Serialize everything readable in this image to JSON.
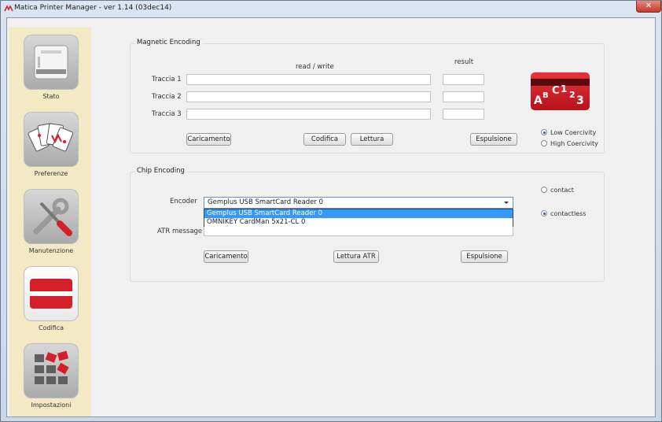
{
  "window": {
    "title": "Matica Printer Manager - ver 1.14 (03dec14)",
    "close_glyph": "✕"
  },
  "sidebar": {
    "items": [
      {
        "label": "Stato",
        "icon": "printer-icon",
        "active": false
      },
      {
        "label": "Preferenze",
        "icon": "playing-cards-icon",
        "active": false
      },
      {
        "label": "Manutenzione",
        "icon": "tools-icon",
        "active": false
      },
      {
        "label": "Codifica",
        "icon": "card-encoding-icon",
        "active": true
      },
      {
        "label": "Impostazioni",
        "icon": "settings-grid-icon",
        "active": false
      }
    ]
  },
  "magnetic": {
    "title": "Magnetic Encoding",
    "col_readwrite": "read / write",
    "col_result": "result",
    "tracks": [
      {
        "label": "Traccia 1",
        "value": "",
        "result": ""
      },
      {
        "label": "Traccia 2",
        "value": "",
        "result": ""
      },
      {
        "label": "Traccia 3",
        "value": "",
        "result": ""
      }
    ],
    "buttons": {
      "load": "Caricamento",
      "encode": "Codifica",
      "read": "Lettura",
      "eject": "Espulsione"
    },
    "coercivity": [
      {
        "label": "Low Coercivity",
        "selected": true
      },
      {
        "label": "High Coercivity",
        "selected": false
      }
    ],
    "logo_chars": {
      "a": "A",
      "b": "B",
      "c": "C",
      "one": "1",
      "two": "2",
      "three": "3"
    }
  },
  "chip": {
    "title": "Chip Encoding",
    "encoder_label": "Encoder",
    "encoder_selected": "Gemplus USB SmartCard Reader 0",
    "encoder_options": [
      {
        "label": "Gemplus USB SmartCard Reader 0",
        "highlighted": true
      },
      {
        "label": "OMNIKEY CardMan 5x21-CL 0",
        "highlighted": false
      }
    ],
    "atr_label": "ATR message",
    "atr_value": "",
    "modes": [
      {
        "label": "contact",
        "selected": false
      },
      {
        "label": "contactless",
        "selected": true
      }
    ],
    "buttons": {
      "load": "Caricamento",
      "read_atr": "Lettura ATR",
      "eject": "Espulsione"
    }
  },
  "colors": {
    "accent_red": "#d4202a",
    "sidebar_bg": "#f3e9c4",
    "selection_blue": "#3399ff"
  }
}
